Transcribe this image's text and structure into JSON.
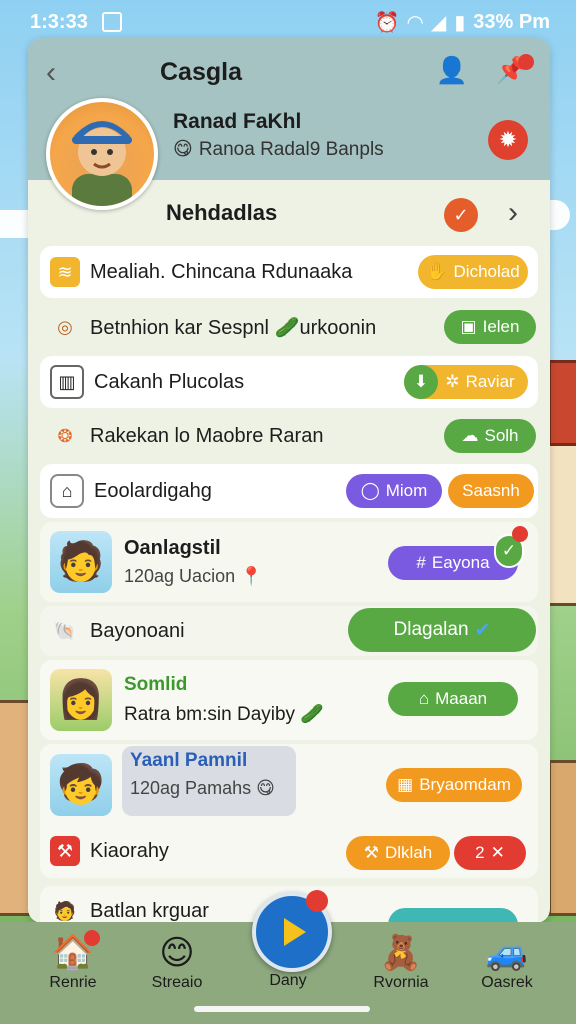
{
  "status": {
    "time": "1:3:33",
    "battery": "33% Pm"
  },
  "header": {
    "title": "Casgla",
    "name": "Ranad FaKhl",
    "subtitle": "Ranoa Radal9 Banpls"
  },
  "section": {
    "title": "Nehdadlas"
  },
  "rows": [
    {
      "label": "Mealiah. Chincana Rdunaaka",
      "pill": "Dicholad"
    },
    {
      "label": "Betnhion kar Sespnl",
      "label2": "urkoonin",
      "pill": "Ielen"
    },
    {
      "label": "Cakanh Plucolas",
      "pill": "Raviar"
    },
    {
      "label": "Rakekan lo Maobre Raran",
      "pill": "Solh"
    },
    {
      "label": "Eoolardigahg",
      "pill_a": "Miom",
      "pill_b": "Saasnh"
    }
  ],
  "card1": {
    "name": "Oanlagstil",
    "sub": "120ag Uacion",
    "pill": "Eayona"
  },
  "row6": {
    "label": "Bayonoani",
    "pill": "Dlagalan"
  },
  "card2": {
    "name": "Somlid",
    "sub": "Ratra bm:sin Dayiby",
    "pill": "Maaan"
  },
  "card3": {
    "name": "Yaanl Pamnil",
    "sub": "120ag Pamahs",
    "pill": "Bryaomdam"
  },
  "row7": {
    "label": "Kiaorahy",
    "pill_a": "Dlklah",
    "pill_b": "2"
  },
  "row8": {
    "label": "Batlan krguar"
  },
  "nav": {
    "home": "Renrie",
    "studio": "Streaio",
    "play": "Dany",
    "rooms": "Rvornia",
    "search": "Oasrek"
  },
  "colors": {
    "header": "#a5c3c2",
    "yellow": "#f2b62e",
    "green": "#58a944",
    "purple": "#7a5ae0",
    "orange": "#f29a1f",
    "red": "#e23b32",
    "blue": "#1e6fc7"
  }
}
